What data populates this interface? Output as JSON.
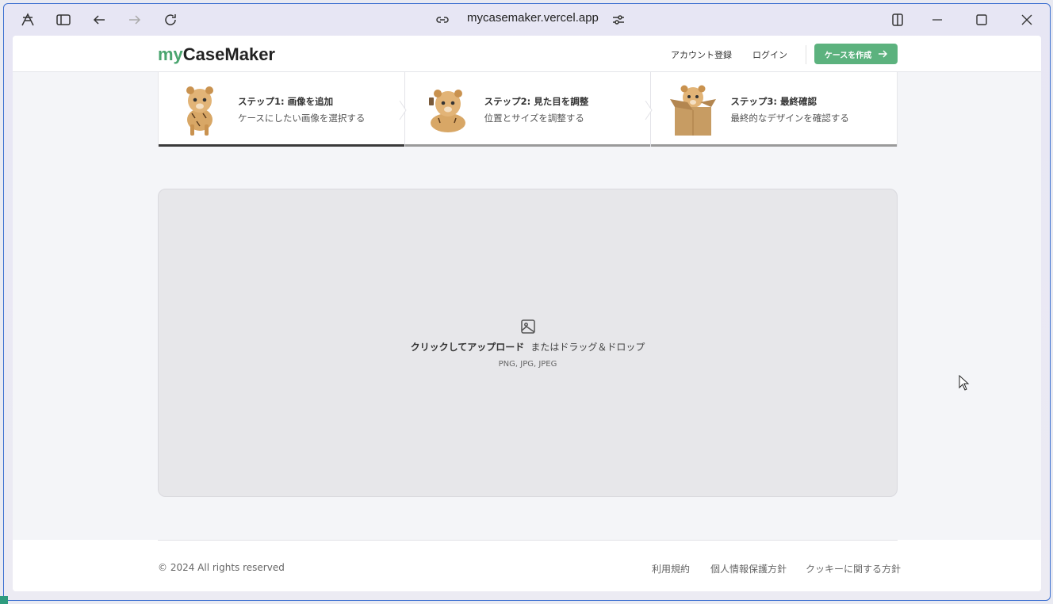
{
  "browser": {
    "url": "mycasemaker.vercel.app"
  },
  "header": {
    "logo_prefix": "my",
    "logo_main": "CaseMaker",
    "register_label": "アカウント登録",
    "login_label": "ログイン",
    "cta_label": "ケースを作成"
  },
  "steps": [
    {
      "title": "ステップ1: 画像を追加",
      "description": "ケースにしたい画像を選択する",
      "active": true
    },
    {
      "title": "ステップ2: 見た目を調整",
      "description": "位置とサイズを調整する",
      "active": false
    },
    {
      "title": "ステップ3: 最終確認",
      "description": "最終的なデザインを確認する",
      "active": false
    }
  ],
  "upload": {
    "primary": "クリックしてアップロード",
    "secondary": "またはドラッグ＆ドロップ",
    "types": "PNG, JPG, JPEG"
  },
  "footer": {
    "copyright": "© 2024 All rights reserved",
    "terms": "利用規約",
    "privacy": "個人情報保護方針",
    "cookies": "クッキーに関する方針"
  },
  "colors": {
    "accent": "#5cb27e",
    "logo_accent": "#4aa56f"
  }
}
